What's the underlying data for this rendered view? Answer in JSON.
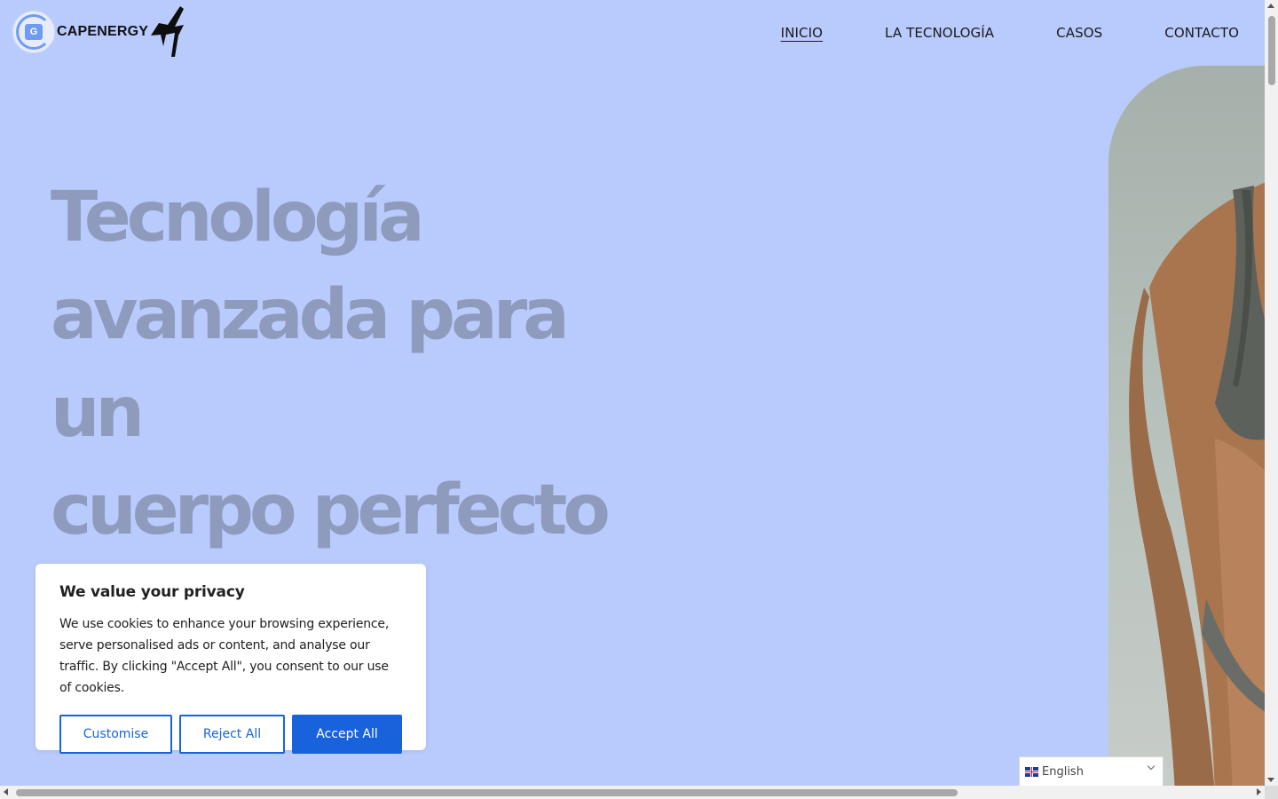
{
  "header": {
    "brand": "CAPENERGY",
    "translate_glyph": "G",
    "nav": [
      {
        "label": "INICIO",
        "active": true
      },
      {
        "label": "LA TECNOLOGÍA",
        "active": false
      },
      {
        "label": "CASOS",
        "active": false
      },
      {
        "label": "CONTACTO",
        "active": false
      }
    ]
  },
  "hero": {
    "title_lines": [
      "Tecnología",
      "avanzada para un",
      "cuerpo perfecto"
    ]
  },
  "cookie_banner": {
    "title": "We value your privacy",
    "body": "We use cookies to enhance your browsing experience, serve personalised ads or content, and analyse our traffic. By clicking \"Accept All\", you consent to our use of cookies.",
    "customise_label": "Customise",
    "reject_label": "Reject All",
    "accept_label": "Accept All"
  },
  "language": {
    "selected": "English",
    "flag_icon": "uk-flag-icon"
  },
  "colors": {
    "background": "#b9cafc",
    "hero_text": "#8e9bbd",
    "primary_button": "#1863dc"
  }
}
